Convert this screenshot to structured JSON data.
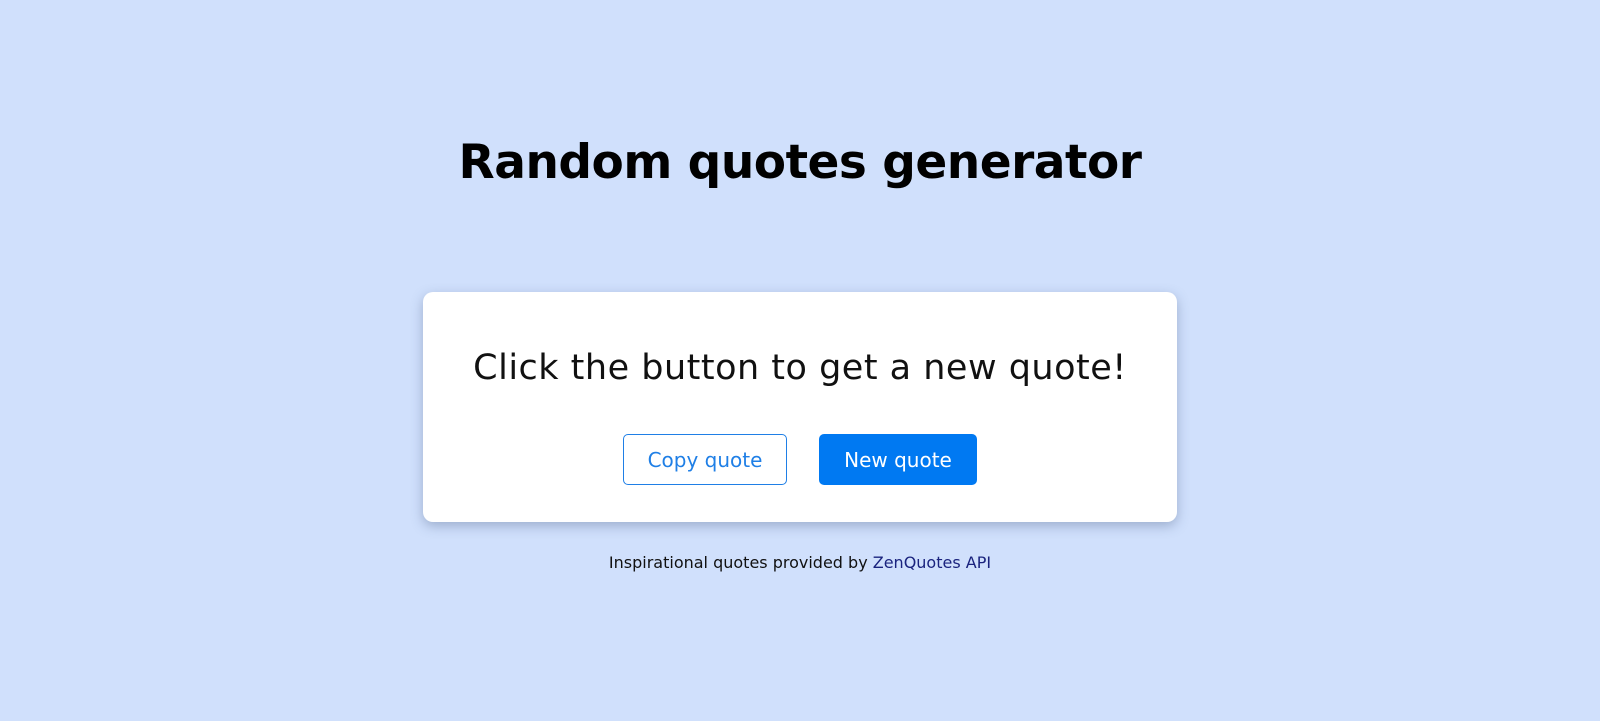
{
  "header": {
    "title": "Random quotes generator"
  },
  "card": {
    "quote": "Click the button to get a new quote!",
    "copy_button_label": "Copy quote",
    "new_button_label": "New quote"
  },
  "footer": {
    "prefix": "Inspirational quotes provided by ",
    "link_text": "ZenQuotes API"
  },
  "colors": {
    "background": "#d0e0fc",
    "accent": "#0079f2",
    "link": "#1a237e"
  }
}
